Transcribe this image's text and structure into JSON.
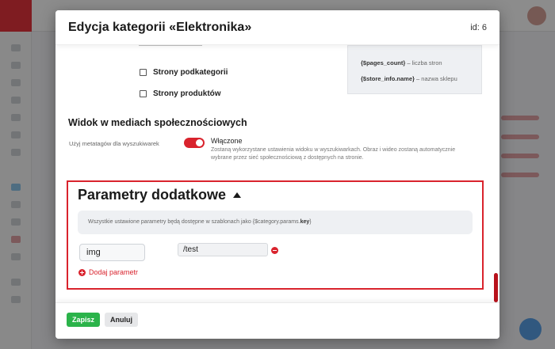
{
  "modal": {
    "title": "Edycja kategorii «Elektronika»",
    "id_label": "id: 6"
  },
  "pagination_options": {
    "items": [
      {
        "label": "Strony podkategorii",
        "checked": false
      },
      {
        "label": "Strony produktów",
        "checked": false
      }
    ]
  },
  "variables": [
    {
      "code": "{$pages_count}",
      "sep": " – ",
      "desc": "liczba stron"
    },
    {
      "code": "{$store_info.name}",
      "sep": " – ",
      "desc": "nazwa sklepu"
    }
  ],
  "social": {
    "title": "Widok w mediach społecznościowych",
    "toggle_label": "Użyj metatagów dla wyszukiwarek",
    "state": "Włączone",
    "enabled": true,
    "description": "Zostaną wykorzystane ustawienia widoku w wyszukiwarkach. Obraz i wideo zostaną automatycznie wybrane przez sieć społecznościową z dostępnych na stronie."
  },
  "params": {
    "title": "Parametry dodatkowe",
    "info_prefix": "Wszystkie ustawione parametry będą dostępne w szablonach jako {$category.params.",
    "info_key": "key",
    "info_suffix": "}",
    "rows": [
      {
        "name": "img",
        "value": "/test"
      }
    ],
    "add_label": "Dodaj parametr"
  },
  "footer": {
    "save_label": "Zapisz",
    "cancel_label": "Anuluj"
  },
  "colors": {
    "accent": "#d9232d",
    "save": "#2bb34a"
  }
}
